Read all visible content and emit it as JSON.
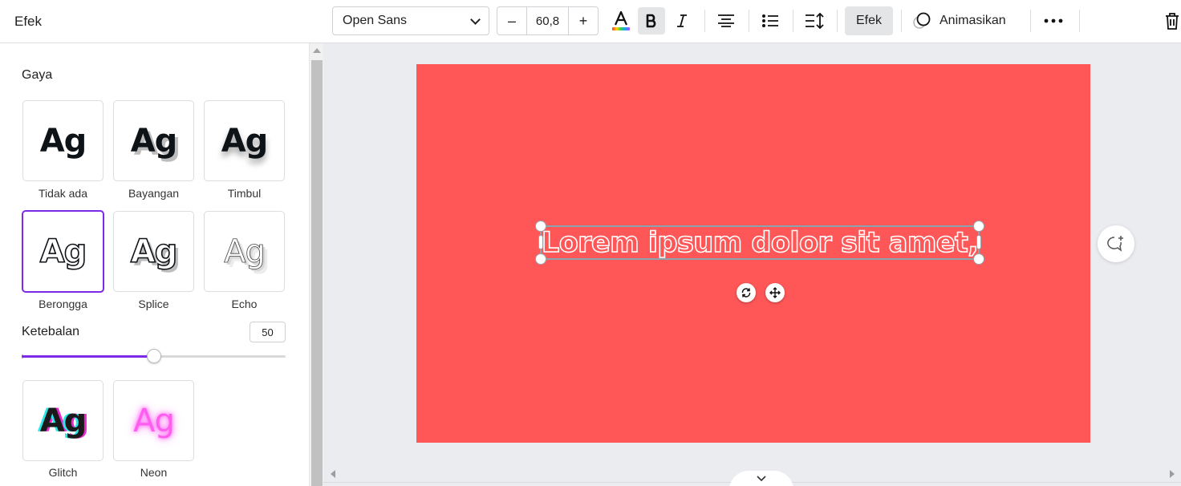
{
  "panel": {
    "title": "Efek",
    "section_title": "Gaya",
    "styles": [
      {
        "label": "Tidak ada",
        "sample": "Ag"
      },
      {
        "label": "Bayangan",
        "sample": "Ag"
      },
      {
        "label": "Timbul",
        "sample": "Ag"
      },
      {
        "label": "Berongga",
        "sample": "Ag",
        "selected": true
      },
      {
        "label": "Splice",
        "sample": "Ag"
      },
      {
        "label": "Echo",
        "sample": "Ag"
      },
      {
        "label": "Glitch",
        "sample": "Ag"
      },
      {
        "label": "Neon",
        "sample": "Ag"
      }
    ],
    "thickness": {
      "label": "Ketebalan",
      "value": "50",
      "fraction": 0.5
    }
  },
  "toolbar": {
    "font_family": "Open Sans",
    "decrease": "–",
    "font_size": "60,8",
    "increase": "+",
    "effects_label": "Efek",
    "animate_label": "Animasikan",
    "text_color_bar": [
      "#ff3b3b",
      "#ffd400",
      "#2bd15a",
      "#1ea0ff",
      "#b04cff"
    ],
    "accent": "#7d2ae8"
  },
  "canvas": {
    "background": "#ff5757",
    "text": "Lorem ipsum dolor sit amet,"
  }
}
